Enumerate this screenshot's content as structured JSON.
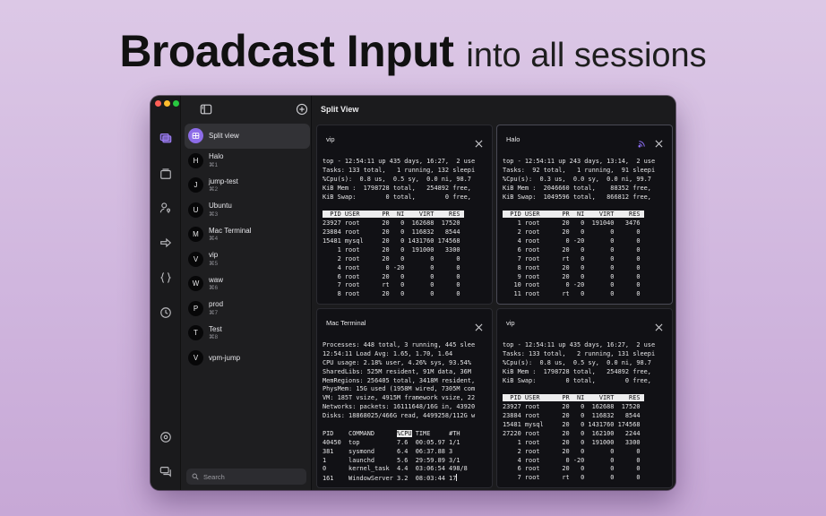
{
  "headline": {
    "bold": "Broadcast Input",
    "light": "into all sessions"
  },
  "colors": {
    "accent": "#8d6ce8",
    "traffic_red": "#ff5f57",
    "traffic_yellow": "#febc2e",
    "traffic_green": "#28c840"
  },
  "icon_bar": {
    "icons": [
      "sessions-icon",
      "folder-icon",
      "user-key-icon",
      "port-forward-icon",
      "snippets-icon",
      "history-icon",
      "settings-icon",
      "chat-icon"
    ]
  },
  "sidebar": {
    "sessions": [
      {
        "avatar": "",
        "name": "Split view",
        "shortcut": ""
      },
      {
        "avatar": "H",
        "name": "Halo",
        "shortcut": "⌘1"
      },
      {
        "avatar": "J",
        "name": "jump-test",
        "shortcut": "⌘2"
      },
      {
        "avatar": "U",
        "name": "Ubuntu",
        "shortcut": "⌘3"
      },
      {
        "avatar": "M",
        "name": "Mac Terminal",
        "shortcut": "⌘4"
      },
      {
        "avatar": "V",
        "name": "vip",
        "shortcut": "⌘5"
      },
      {
        "avatar": "W",
        "name": "waw",
        "shortcut": "⌘6"
      },
      {
        "avatar": "P",
        "name": "prod",
        "shortcut": "⌘7"
      },
      {
        "avatar": "T",
        "name": "Test",
        "shortcut": "⌘8"
      },
      {
        "avatar": "V",
        "name": "vpm-jump",
        "shortcut": ""
      }
    ],
    "search_placeholder": "Search"
  },
  "main": {
    "title": "Split View",
    "panes": [
      {
        "title": "vip",
        "broadcast": false,
        "lines": [
          {
            "t": "top - 12:54:11 up 435 days, 16:27,  2 use"
          },
          {
            "t": "Tasks: 133 total,   1 running, 132 sleepi"
          },
          {
            "t": "%Cpu(s):  0.8 us,  0.5 sy,  0.0 ni, 98.7"
          },
          {
            "t": "KiB Mem :  1798728 total,   254892 free,"
          },
          {
            "t": "KiB Swap:        0 total,        0 free,"
          },
          {
            "t": ""
          },
          {
            "t": "  PID USER      PR  NI    VIRT    RES ",
            "hl": true
          },
          {
            "t": "23927 root      20   0  162688  17520"
          },
          {
            "t": "23884 root      20   0  116832   8544"
          },
          {
            "t": "15481 mysql     20   0 1431760 174568"
          },
          {
            "t": "    1 root      20   0  191000   3300"
          },
          {
            "t": "    2 root      20   0       0      0"
          },
          {
            "t": "    4 root       0 -20       0      0"
          },
          {
            "t": "    6 root      20   0       0      0"
          },
          {
            "t": "    7 root      rt   0       0      0"
          },
          {
            "t": "    8 root      20   0       0      0"
          }
        ]
      },
      {
        "title": "Halo",
        "broadcast": true,
        "lines": [
          {
            "t": "top - 12:54:11 up 243 days, 13:14,  2 use"
          },
          {
            "t": "Tasks:  92 total,   1 running,  91 sleepi"
          },
          {
            "t": "%Cpu(s):  0.3 us,  0.0 sy,  0.0 ni, 99.7"
          },
          {
            "t": "KiB Mem :  2046660 total,    88352 free,"
          },
          {
            "t": "KiB Swap:  1049596 total,   866812 free,"
          },
          {
            "t": ""
          },
          {
            "t": "  PID USER      PR  NI    VIRT    RES ",
            "hl": true
          },
          {
            "t": "    1 root      20   0  191040   3476"
          },
          {
            "t": "    2 root      20   0       0      0"
          },
          {
            "t": "    4 root       0 -20       0      0"
          },
          {
            "t": "    6 root      20   0       0      0"
          },
          {
            "t": "    7 root      rt   0       0      0"
          },
          {
            "t": "    8 root      20   0       0      0"
          },
          {
            "t": "    9 root      20   0       0      0"
          },
          {
            "t": "   10 root       0 -20       0      0"
          },
          {
            "t": "   11 root      rt   0       0      0"
          }
        ]
      },
      {
        "title": "Mac Terminal",
        "broadcast": false,
        "lines": [
          {
            "t": "Processes: 448 total, 3 running, 445 slee"
          },
          {
            "t": "12:54:11 Load Avg: 1.65, 1.70, 1.64"
          },
          {
            "t": "CPU usage: 2.18% user, 4.26% sys, 93.54%"
          },
          {
            "t": "SharedLibs: 525M resident, 91M data, 36M"
          },
          {
            "t": "MemRegions: 256405 total, 3418M resident,"
          },
          {
            "t": "PhysMem: 15G used (1958M wired, 7305M com"
          },
          {
            "t": "VM: 185T vsize, 4915M framework vsize, 22"
          },
          {
            "t": "Networks: packets: 16111648/16G in, 43920"
          },
          {
            "t": "Disks: 18868025/466G read, 4499258/112G w"
          },
          {
            "t": ""
          },
          {
            "t": "PID    COMMAND      ",
            "hl_part": "%CPU",
            "rest": " TIME     #TH"
          },
          {
            "t": "40450  top          7.6  00:05.97 1/1"
          },
          {
            "t": "381    sysmond      6.4  06:37.88 3"
          },
          {
            "t": "1      launchd      5.6  29:59.89 3/1"
          },
          {
            "t": "0      kernel_task  4.4  03:06:54 498/8"
          },
          {
            "t": "161    WindowServer 3.2  08:03:44 17",
            "cursor": true
          }
        ]
      },
      {
        "title": "vip",
        "broadcast": false,
        "lines": [
          {
            "t": "top - 12:54:11 up 435 days, 16:27,  2 use"
          },
          {
            "t": "Tasks: 133 total,   2 running, 131 sleepi"
          },
          {
            "t": "%Cpu(s):  0.8 us,  0.5 sy,  0.0 ni, 98.7"
          },
          {
            "t": "KiB Mem :  1798728 total,   254892 free,"
          },
          {
            "t": "KiB Swap:        0 total,        0 free,"
          },
          {
            "t": ""
          },
          {
            "t": "  PID USER      PR  NI    VIRT    RES ",
            "hl": true
          },
          {
            "t": "23927 root      20   0  162688  17520"
          },
          {
            "t": "23884 root      20   0  116832   8544"
          },
          {
            "t": "15481 mysql     20   0 1431760 174568"
          },
          {
            "t": "27220 root      20   0  162100   2244"
          },
          {
            "t": "    1 root      20   0  191000   3300"
          },
          {
            "t": "    2 root      20   0       0      0"
          },
          {
            "t": "    4 root       0 -20       0      0"
          },
          {
            "t": "    6 root      20   0       0      0"
          },
          {
            "t": "    7 root      rt   0       0      0"
          }
        ]
      }
    ]
  }
}
